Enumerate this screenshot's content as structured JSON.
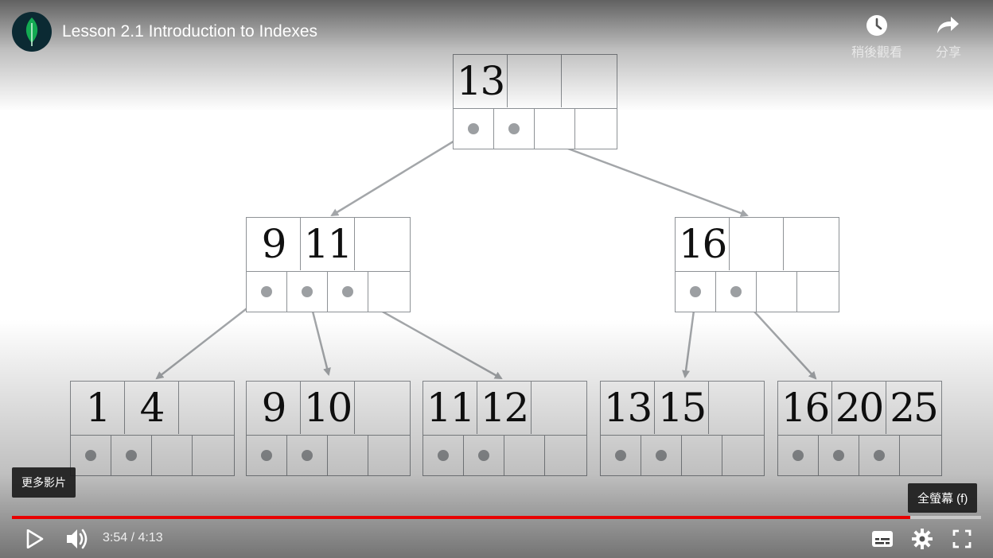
{
  "video": {
    "title": "Lesson 2.1 Introduction to Indexes",
    "channel_logo_icon": "leaf-icon",
    "watch_later_label": "稍後觀看",
    "share_label": "分享",
    "more_videos_label": "更多影片",
    "fullscreen_tooltip": "全螢幕 (f)",
    "current_time": "3:54",
    "time_separator": " / ",
    "duration": "4:13",
    "progress": 0.927
  },
  "diagram": {
    "root": {
      "keys": [
        "13",
        "",
        ""
      ]
    },
    "level2": [
      {
        "keys": [
          "9",
          "11",
          ""
        ]
      },
      {
        "keys": [
          "16",
          "",
          ""
        ]
      }
    ],
    "leaves": [
      {
        "keys": [
          "1",
          "4",
          ""
        ]
      },
      {
        "keys": [
          "9",
          "10",
          ""
        ]
      },
      {
        "keys": [
          "11",
          "12",
          ""
        ]
      },
      {
        "keys": [
          "13",
          "15",
          ""
        ]
      },
      {
        "keys": [
          "16",
          "20",
          "25"
        ]
      }
    ]
  },
  "colors": {
    "progress": "#e80000",
    "line": "#8e9296",
    "leaf": "#13aa52"
  }
}
